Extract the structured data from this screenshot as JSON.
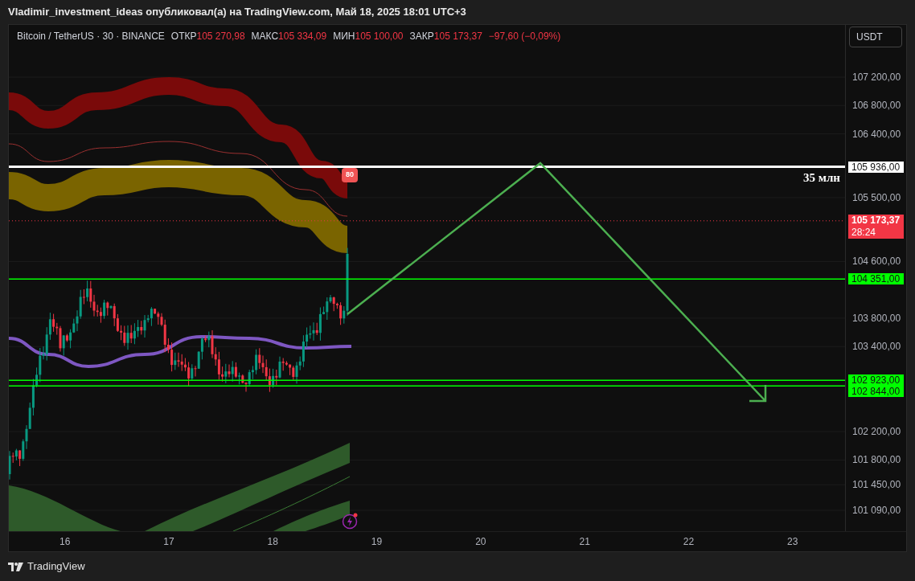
{
  "header": {
    "title": "Vladimir_investment_ideas опубликовал(а) на TradingView.com, Май 18, 2025 18:01 UTC+3"
  },
  "legend": {
    "symbol": "Bitcoin / TetherUS · 30 · BINANCE",
    "fields": [
      {
        "label": "ОТКР",
        "value": "105 270,98"
      },
      {
        "label": "МАКС",
        "value": "105 334,09"
      },
      {
        "label": "МИН",
        "value": "105 100,00"
      },
      {
        "label": "ЗАКР",
        "value": "105 173,37"
      }
    ],
    "change": "−97,60 (−0,09%)"
  },
  "currency_button": "USDT",
  "price_axis": [
    "107 200,00",
    "106 800,00",
    "106 400,00",
    "105 500,00",
    "104 600,00",
    "103 800,00",
    "103 400,00",
    "102 200,00",
    "101 800,00",
    "101 450,00",
    "101 090,00"
  ],
  "price_lines": [
    {
      "kind": "level",
      "value": "105 936,00",
      "color": "#ffffff"
    },
    {
      "kind": "current",
      "value": "105 173,37",
      "timer": "28:24",
      "color": "#f23645"
    },
    {
      "kind": "level",
      "value": "104 351,00",
      "color": "#00ff00"
    },
    {
      "kind": "level",
      "value": "102 923,00",
      "color": "#00ff00"
    },
    {
      "kind": "level",
      "value": "102 844,00",
      "color": "#00ff00"
    }
  ],
  "annotation": "35 млн",
  "signal_marker": "80",
  "time_axis": [
    "16",
    "17",
    "18",
    "19",
    "20",
    "21",
    "22",
    "23"
  ],
  "footer": {
    "brand": "TradingView"
  }
}
